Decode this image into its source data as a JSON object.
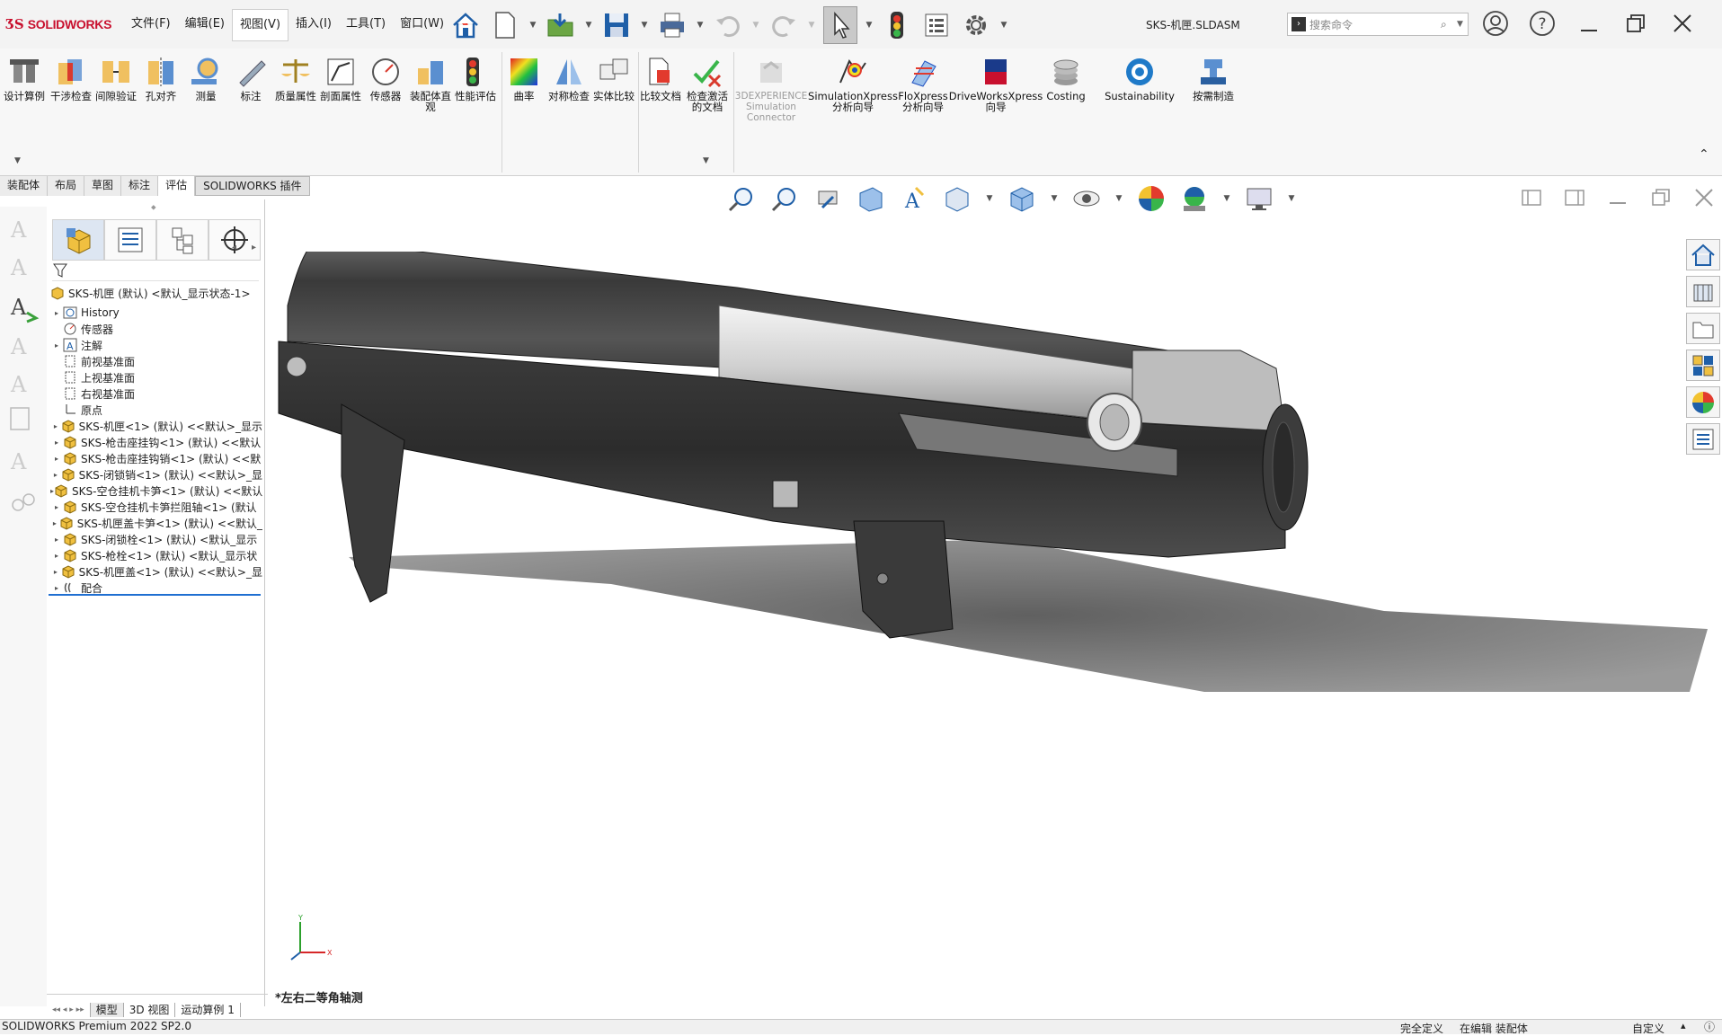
{
  "app": {
    "brand": "SOLIDWORKS",
    "document_title": "SKS-机匣.SLDASM"
  },
  "menus": [
    "文件(F)",
    "编辑(E)",
    "视图(V)",
    "插入(I)",
    "工具(T)",
    "窗口(W)"
  ],
  "menu_selected_index": 2,
  "search": {
    "placeholder": "搜索命令"
  },
  "ribbon": {
    "buttons": [
      "设计算例",
      "干涉检查",
      "间隙验证",
      "孔对齐",
      "测量",
      "标注",
      "质量属性",
      "剖面属性",
      "传感器",
      "装配体直观",
      "性能评估",
      "曲率",
      "对称检查",
      "实体比较",
      "比较文档",
      "检查激活的文档",
      "3DEXPERIENCE Simulation Connector",
      "SimulationXpress 分析向导",
      "FloXpress 分析向导",
      "DriveWorksXpress 向导",
      "Costing",
      "Sustainability",
      "按需制造"
    ]
  },
  "command_tabs": [
    "装配体",
    "布局",
    "草图",
    "标注",
    "评估",
    "SOLIDWORKS 插件"
  ],
  "command_tab_selected": 4,
  "tree": {
    "root": "SKS-机匣 (默认) <默认_显示状态-1>",
    "items": [
      {
        "label": "History",
        "expandable": true,
        "icon": "history-icon"
      },
      {
        "label": "传感器",
        "expandable": false,
        "icon": "sensor-icon"
      },
      {
        "label": "注解",
        "expandable": true,
        "icon": "annotation-icon"
      },
      {
        "label": "前视基准面",
        "expandable": false,
        "icon": "plane-icon"
      },
      {
        "label": "上视基准面",
        "expandable": false,
        "icon": "plane-icon"
      },
      {
        "label": "右视基准面",
        "expandable": false,
        "icon": "plane-icon"
      },
      {
        "label": "原点",
        "expandable": false,
        "icon": "origin-icon"
      },
      {
        "label": "SKS-机匣<1> (默认) <<默认>_显示",
        "expandable": true,
        "icon": "part-icon"
      },
      {
        "label": "SKS-枪击座挂钩<1> (默认) <<默认",
        "expandable": true,
        "icon": "part-icon"
      },
      {
        "label": "SKS-枪击座挂钩销<1> (默认) <<默",
        "expandable": true,
        "icon": "part-icon"
      },
      {
        "label": "SKS-闭锁销<1> (默认) <<默认>_显",
        "expandable": true,
        "icon": "part-icon"
      },
      {
        "label": "SKS-空仓挂机卡笋<1> (默认) <<默认",
        "expandable": true,
        "icon": "part-icon"
      },
      {
        "label": "SKS-空仓挂机卡笋拦阻轴<1> (默认",
        "expandable": true,
        "icon": "part-icon"
      },
      {
        "label": "SKS-机匣盖卡笋<1> (默认) <<默认_",
        "expandable": true,
        "icon": "part-icon"
      },
      {
        "label": "SKS-闭锁栓<1> (默认) <默认_显示",
        "expandable": true,
        "icon": "part-icon"
      },
      {
        "label": "SKS-枪栓<1> (默认) <默认_显示状",
        "expandable": true,
        "icon": "part-icon"
      },
      {
        "label": "SKS-机匣盖<1> (默认) <<默认>_显",
        "expandable": true,
        "icon": "part-icon"
      },
      {
        "label": "配合",
        "expandable": true,
        "icon": "mates-icon"
      }
    ]
  },
  "viewport": {
    "view_name": "*左右二等角轴测",
    "triad": {
      "x": "X",
      "y": "Y",
      "z": "Z"
    }
  },
  "bottom_tabs": [
    "模型",
    "3D 视图",
    "运动算例 1"
  ],
  "bottom_tab_selected": 0,
  "status": {
    "product": "SOLIDWORKS Premium 2022 SP2.0",
    "definition": "完全定义",
    "editing": "在编辑 装配体",
    "units": "自定义"
  },
  "colors": {
    "brand_red": "#c8102e",
    "selection_blue": "#1f6fd1"
  }
}
